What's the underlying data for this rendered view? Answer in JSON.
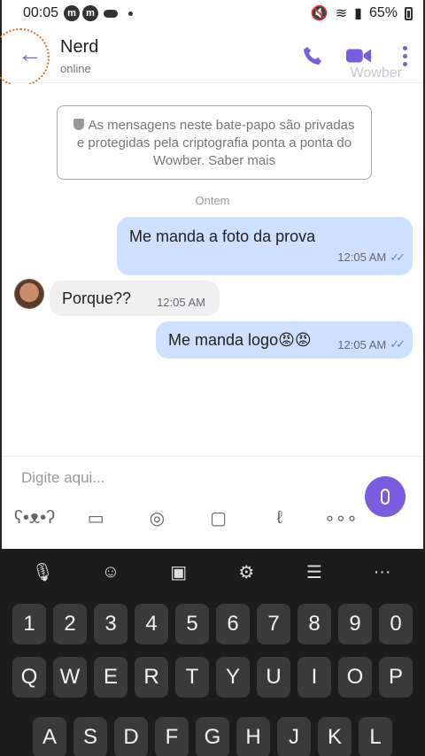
{
  "status_bar": {
    "time": "00:05",
    "notif_icons": [
      "m",
      "m"
    ],
    "battery": "65%"
  },
  "header": {
    "contact_name": "Nerd",
    "contact_status": "online",
    "watermark": "Wowber",
    "icons": [
      "back-arrow-icon",
      "phone-icon",
      "video-camera-icon",
      "more-vertical-icon"
    ],
    "accent_color": "#7a5ce0"
  },
  "chat": {
    "encryption_notice": "As mensagens neste bate-papo são privadas e protegidas pela criptografia ponta a ponta do Wowber. Saber mais",
    "date_separator": "Ontem",
    "messages": [
      {
        "direction": "out",
        "text": "Me manda a foto da prova",
        "time": "12:05 AM",
        "read": true
      },
      {
        "direction": "in",
        "text": "Porque??",
        "time": "12:05 AM"
      },
      {
        "direction": "out",
        "text": "Me manda logo😡😡",
        "time": "12:05 AM",
        "read": true
      }
    ],
    "read_ticks": "✓✓"
  },
  "composer": {
    "placeholder": "Digite aqui...",
    "tools": [
      "sticker-icon",
      "gallery-icon",
      "camera-icon",
      "gif-icon",
      "doodle-icon",
      "more-horizontal-icon"
    ]
  },
  "keyboard": {
    "toolbar": [
      "mic-icon",
      "emoji-icon",
      "clipboard-icon",
      "settings-icon",
      "text-edit-icon",
      "more-icon"
    ],
    "more_label": "···",
    "row1": [
      "1",
      "2",
      "3",
      "4",
      "5",
      "6",
      "7",
      "8",
      "9",
      "0"
    ],
    "row2": [
      "Q",
      "W",
      "E",
      "R",
      "T",
      "Y",
      "U",
      "I",
      "O",
      "P"
    ],
    "row3": [
      "A",
      "S",
      "D",
      "F",
      "G",
      "H",
      "J",
      "K",
      "L"
    ]
  }
}
